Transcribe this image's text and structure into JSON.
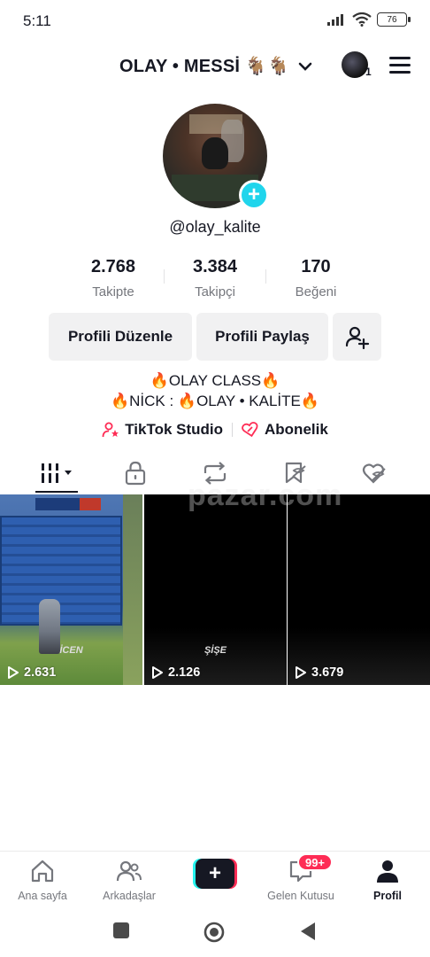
{
  "status_bar": {
    "time": "5:11",
    "battery": "76"
  },
  "header": {
    "account_name": "OLAY • MESSİ 🐐🐐",
    "switch_count": "1"
  },
  "profile": {
    "username": "@olay_kalite"
  },
  "stats": [
    {
      "value": "2.768",
      "label": "Takipte"
    },
    {
      "value": "3.384",
      "label": "Takipçi"
    },
    {
      "value": "170",
      "label": "Beğeni"
    }
  ],
  "actions": {
    "edit_profile": "Profili Düzenle",
    "share_profile": "Profili Paylaş"
  },
  "bio": {
    "line1": "🔥OLAY CLASS🔥",
    "line2": "🔥NİCK : 🔥OLAY • KALİTE🔥"
  },
  "links": {
    "studio": "TikTok Studio",
    "subscription": "Abonelik"
  },
  "tabs": [
    "videos-grid-icon",
    "lock-icon",
    "repost-icon",
    "favorites-icon",
    "liked-icon"
  ],
  "videos": [
    {
      "views": "2.631",
      "caption": "İCEN"
    },
    {
      "views": "2.126",
      "caption": "ŞİŞE"
    },
    {
      "views": "3.679",
      "caption": ""
    }
  ],
  "watermark": "pazar.com",
  "bottom_nav": {
    "home": "Ana sayfa",
    "friends": "Arkadaşlar",
    "create": "+",
    "inbox": "Gelen Kutusu",
    "inbox_badge": "99+",
    "profile": "Profil"
  },
  "colors": {
    "accent_cyan": "#20d5ec",
    "brand_red": "#fe2c55",
    "brand_cyan": "#25f4ee",
    "text": "#161823",
    "muted": "#75777d"
  }
}
